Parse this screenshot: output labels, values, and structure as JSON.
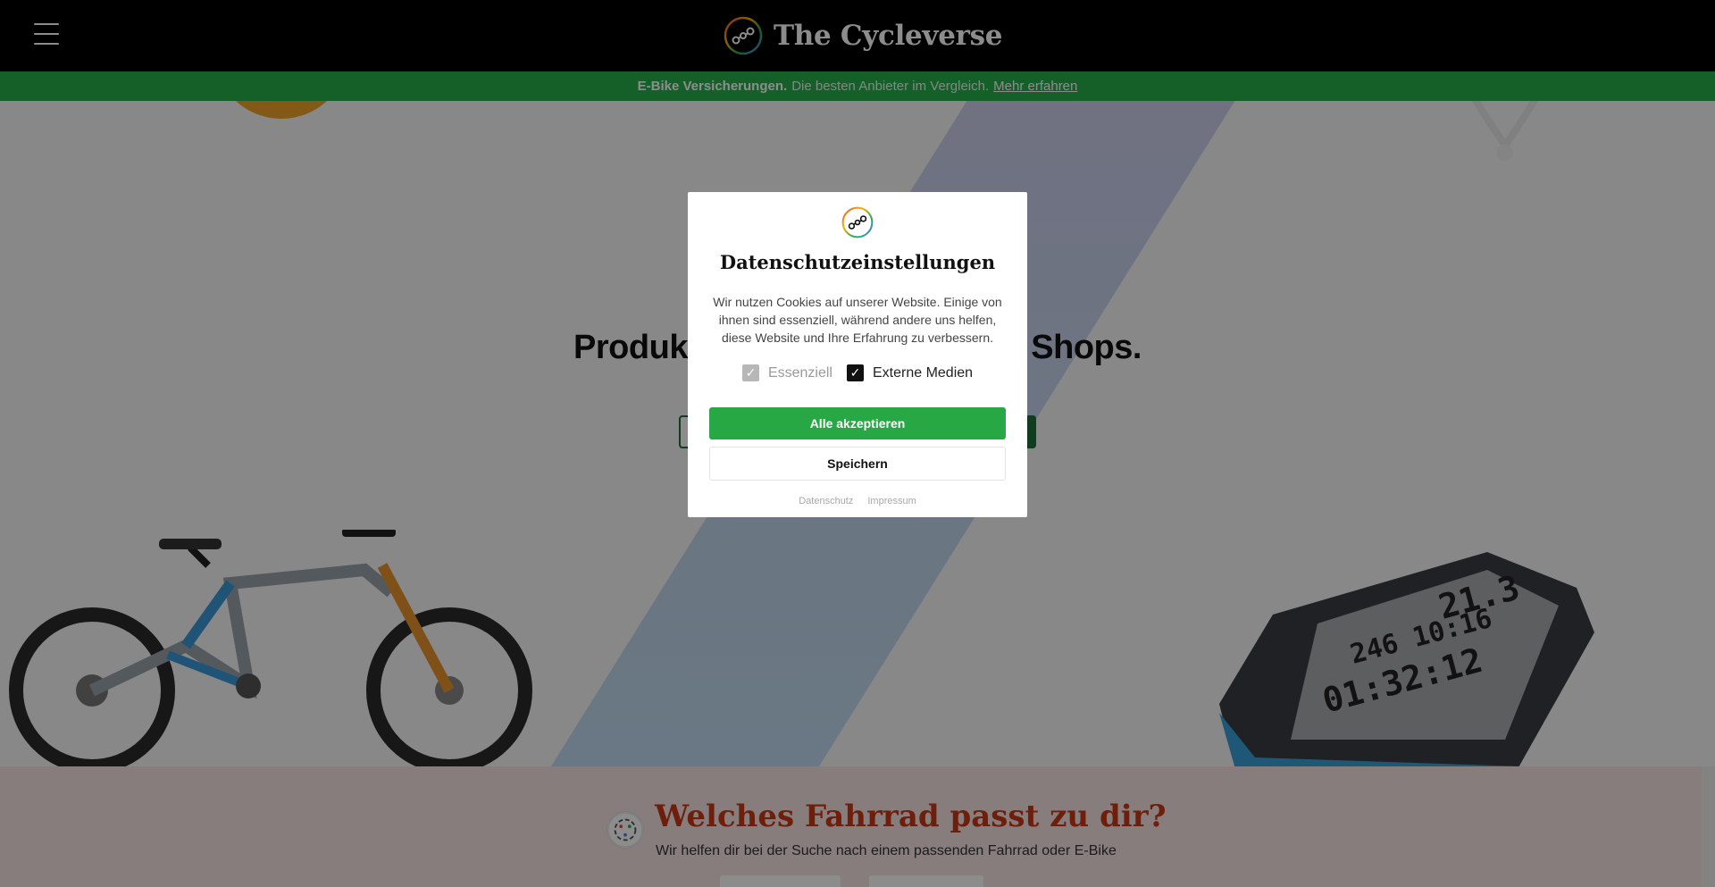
{
  "header": {
    "brand_name": "The Cycleverse",
    "menu_icon": "hamburger-menu-icon",
    "logo_icon": "chain-logo-icon"
  },
  "promo": {
    "bold_text": "E-Bike Versicherungen.",
    "text": "Die besten Anbieter im Vergleich.",
    "link": "Mehr erfahren",
    "color": "#27b04b"
  },
  "hero": {
    "headline": "Produkte aus hunderten von Shops."
  },
  "quiz": {
    "title": "Welches Fahrrad passt zu dir?",
    "subtitle": "Wir helfen dir bei der Suche nach einem passenden Fahrrad oder E-Bike",
    "title_color": "#c83a16"
  },
  "cookie_modal": {
    "title": "Datenschutzeinstellungen",
    "body": "Wir nutzen Cookies auf unserer Website. Einige von ihnen sind essenziell, während andere uns helfen, diese Website und Ihre Erfahrung zu verbessern.",
    "options": [
      {
        "label": "Essenziell",
        "checked": true,
        "disabled": true
      },
      {
        "label": "Externe Medien",
        "checked": true,
        "disabled": false
      }
    ],
    "accept_all_label": "Alle akzeptieren",
    "save_label": "Speichern",
    "links": [
      "Datenschutz",
      "Impressum"
    ],
    "accent_color": "#28a745"
  }
}
